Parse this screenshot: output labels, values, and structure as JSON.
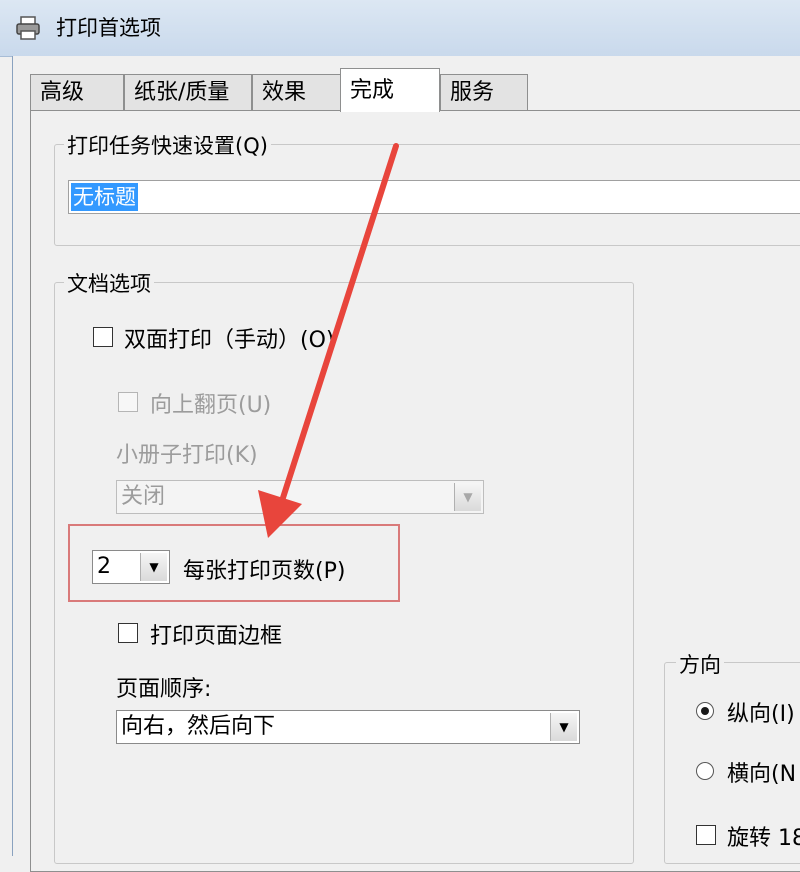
{
  "window": {
    "title": "打印首选项"
  },
  "tabs": [
    {
      "label": "高级"
    },
    {
      "label": "纸张/质量"
    },
    {
      "label": "效果"
    },
    {
      "label": "完成",
      "active": true
    },
    {
      "label": "服务"
    }
  ],
  "quick_settings": {
    "legend": "打印任务快速设置(Q)",
    "value": "无标题"
  },
  "document_options": {
    "legend": "文档选项",
    "duplex": {
      "label": "双面打印（手动）(O)",
      "checked": false
    },
    "flip_up": {
      "label": "向上翻页(U)",
      "checked": false,
      "disabled": true
    },
    "booklet": {
      "label": "小册子打印(K)",
      "value": "关闭",
      "disabled": true
    },
    "pages_per_sheet": {
      "value": "2",
      "label": "每张打印页数(P)"
    },
    "page_borders": {
      "label": "打印页面边框",
      "checked": false
    },
    "page_order": {
      "label": "页面顺序:",
      "value": "向右，然后向下"
    }
  },
  "orientation": {
    "legend": "方向",
    "portrait": {
      "label": "纵向(I)",
      "selected": true
    },
    "landscape": {
      "label": "横向(N",
      "selected": false
    },
    "rotate": {
      "label": "旋转 18",
      "checked": false
    }
  },
  "annotation": {
    "arrow_color": "#e8453c",
    "box_color": "#d97a7a"
  }
}
